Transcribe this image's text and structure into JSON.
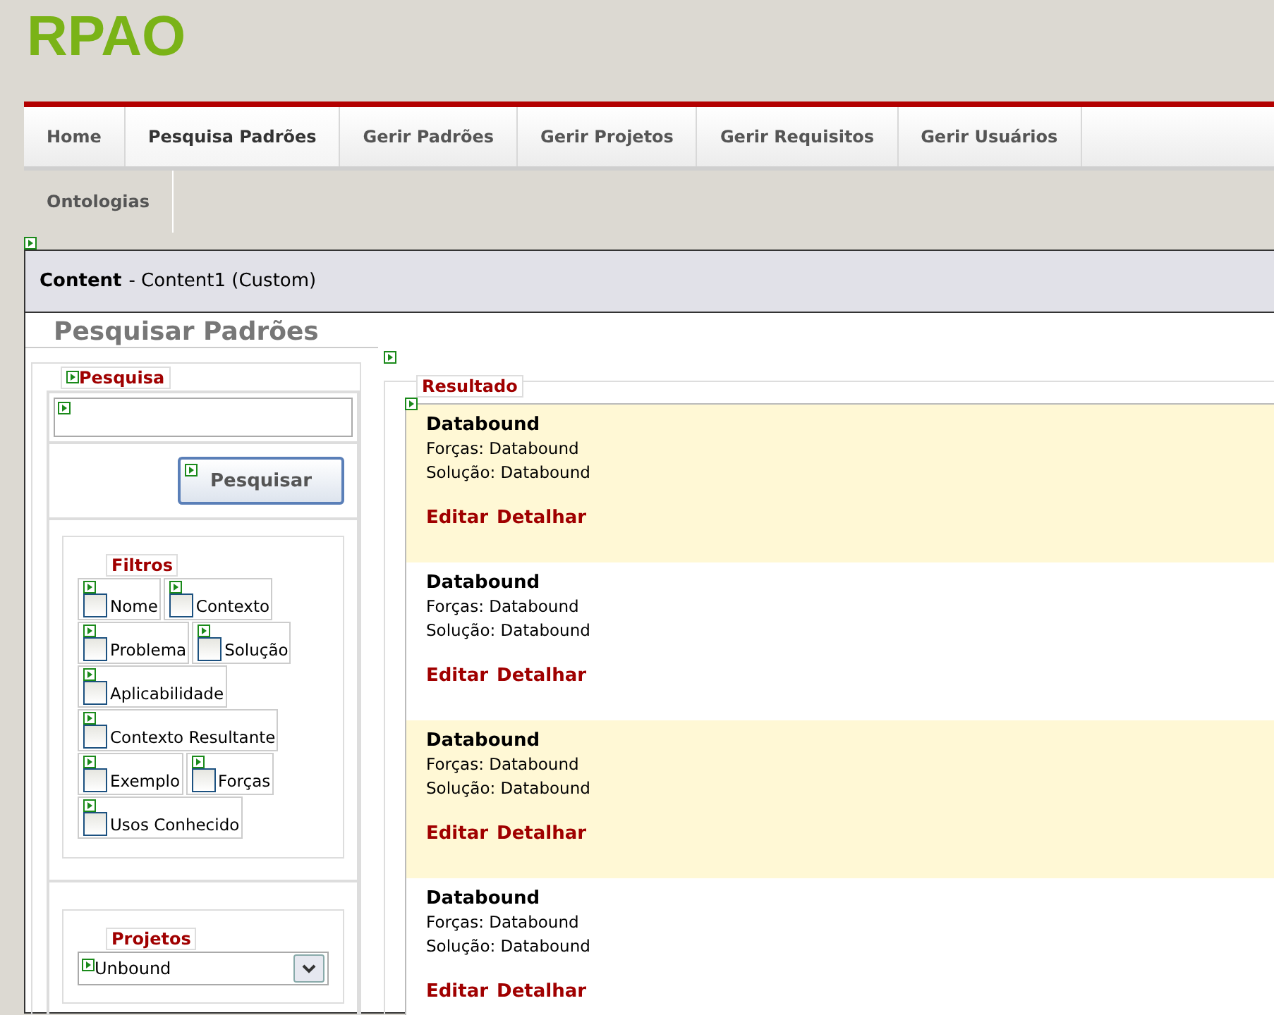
{
  "logo": "RPAO",
  "nav": [
    [
      {
        "label": "Home",
        "selected": false
      },
      {
        "label": "Pesquisa Padrões",
        "selected": true
      },
      {
        "label": "Gerir Padrões",
        "selected": false
      },
      {
        "label": "Gerir Projetos",
        "selected": false
      },
      {
        "label": "Gerir Requisitos",
        "selected": false
      },
      {
        "label": "Gerir Usuários",
        "selected": false
      }
    ],
    [
      {
        "label": "Ontologias",
        "selected": false
      }
    ]
  ],
  "content_header": {
    "title": "Content",
    "subtitle": "- Content1 (Custom)"
  },
  "page_title": "Pesquisar Padrões",
  "search": {
    "legend": "Pesquisa",
    "button": "Pesquisar"
  },
  "filters": {
    "legend": "Filtros",
    "rows": [
      [
        {
          "label": "Nome",
          "checked": false
        },
        {
          "label": "Contexto",
          "checked": false
        }
      ],
      [
        {
          "label": "Problema",
          "checked": false
        },
        {
          "label": "Solução",
          "checked": false
        }
      ],
      [
        {
          "label": "Aplicabilidade",
          "checked": false
        }
      ],
      [
        {
          "label": "Contexto Resultante",
          "checked": false
        }
      ],
      [
        {
          "label": "Exemplo",
          "checked": false
        },
        {
          "label": "Forças",
          "checked": false
        }
      ],
      [
        {
          "label": "Usos Conhecido",
          "checked": false
        }
      ]
    ]
  },
  "projects": {
    "legend": "Projetos",
    "value": "Unbound"
  },
  "results": {
    "legend": "Resultado",
    "items": [
      {
        "title": "Databound",
        "forces": "Forças: Databound",
        "solution": "Solução: Databound",
        "actions": [
          "Editar",
          "Detalhar"
        ],
        "highlighted": true
      },
      {
        "title": "Databound",
        "forces": "Forças: Databound",
        "solution": "Solução: Databound",
        "actions": [
          "Editar",
          "Detalhar"
        ],
        "highlighted": false
      },
      {
        "title": "Databound",
        "forces": "Forças: Databound",
        "solution": "Solução: Databound",
        "actions": [
          "Editar",
          "Detalhar"
        ],
        "highlighted": true
      },
      {
        "title": "Databound",
        "forces": "Forças: Databound",
        "solution": "Solução: Databound",
        "actions": [
          "Editar",
          "Detalhar"
        ],
        "highlighted": false
      }
    ]
  }
}
